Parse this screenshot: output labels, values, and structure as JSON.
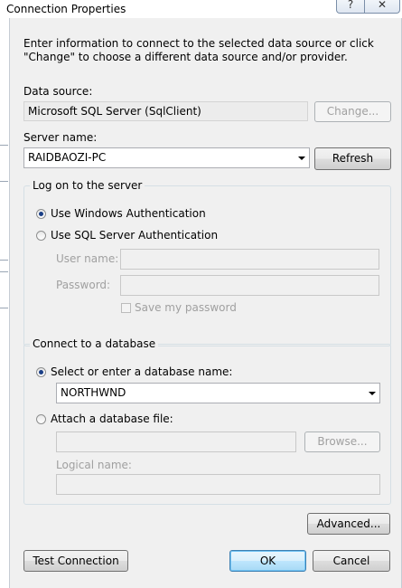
{
  "window": {
    "title": "Connection Properties",
    "help_glyph": "?",
    "close_glyph": "✕"
  },
  "intro_text": "Enter information to connect to the selected data source or click \"Change\" to choose a different data source and/or provider.",
  "data_source": {
    "label": "Data source:",
    "value": "Microsoft SQL Server (SqlClient)",
    "change_button": "Change..."
  },
  "server": {
    "label": "Server name:",
    "value": "RAIDBAOZI-PC",
    "refresh_button": "Refresh"
  },
  "logon": {
    "group_title": "Log on to the server",
    "windows_auth": "Use Windows Authentication",
    "sql_auth": "Use SQL Server Authentication",
    "selected": "windows",
    "username_label": "User name:",
    "password_label": "Password:",
    "save_password": "Save my password"
  },
  "database": {
    "group_title": "Connect to a database",
    "select_option": "Select or enter a database name:",
    "selected_db": "NORTHWND",
    "attach_option": "Attach a database file:",
    "browse_button": "Browse...",
    "logical_name_label": "Logical name:"
  },
  "buttons": {
    "advanced": "Advanced...",
    "test_connection": "Test Connection",
    "ok": "OK",
    "cancel": "Cancel"
  }
}
